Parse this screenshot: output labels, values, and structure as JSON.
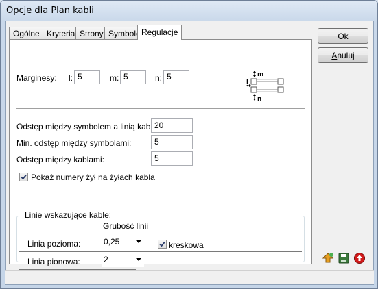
{
  "window": {
    "title": "Opcje dla Plan kabli"
  },
  "tabs": [
    {
      "label": "Ogólne"
    },
    {
      "label": "Kryteria"
    },
    {
      "label": "Strony"
    },
    {
      "label": "Symbole"
    },
    {
      "label": "Regulacje",
      "active": true
    }
  ],
  "margins": {
    "label": "Marginesy:",
    "l_label": "l:",
    "l_value": "5",
    "m_label": "m:",
    "m_value": "5",
    "n_label": "n:",
    "n_value": "5",
    "diagram": {
      "m": "m",
      "n": "n",
      "l": "l"
    }
  },
  "spacing": {
    "symbol_line_label": "Odstęp między symbolem a linią kabla:",
    "symbol_line_value": "20",
    "min_symbols_label": "Min. odstęp między symbolami:",
    "min_symbols_value": "5",
    "cables_label": "Odstęp między kablami:",
    "cables_value": "5"
  },
  "show_wire_numbers": {
    "label": "Pokaż numery żył na żyłach kabla",
    "checked": true
  },
  "lines_group": {
    "title": "Linie wskazujące kable:",
    "col_header": "Grubość linii",
    "horizontal_label": "Linia pozioma:",
    "horizontal_value": "0,25",
    "dashed_label": "kreskowa",
    "dashed_checked": true,
    "vertical_label": "Linia pionowa:",
    "vertical_value": "2"
  },
  "buttons": {
    "ok_accel": "O",
    "ok_rest": "k",
    "cancel_accel": "A",
    "cancel_rest": "nuluj"
  },
  "icons": [
    "load-settings-icon",
    "save-icon",
    "reset-icon"
  ]
}
